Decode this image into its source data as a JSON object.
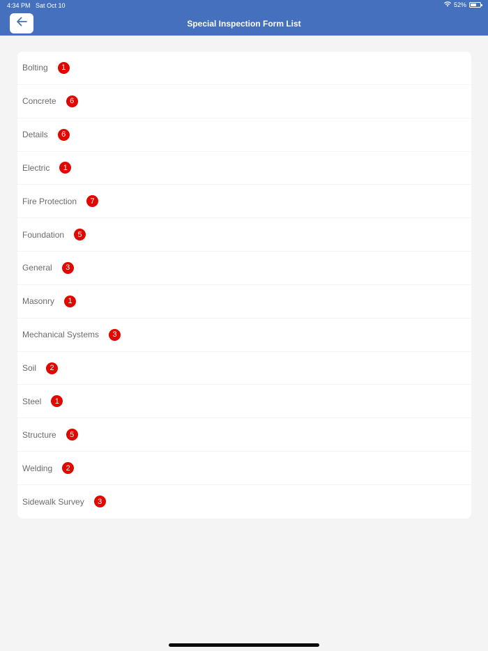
{
  "status_bar": {
    "time": "4:34 PM",
    "date": "Sat Oct 10",
    "battery": "52%"
  },
  "header": {
    "title": "Special Inspection Form List",
    "back_icon": "arrow-left-icon"
  },
  "colors": {
    "header_bg": "#4470bd",
    "badge_bg": "#e10600",
    "page_bg": "#f4f4f5"
  },
  "categories": [
    {
      "label": "Bolting",
      "count": "1"
    },
    {
      "label": "Concrete",
      "count": "6"
    },
    {
      "label": "Details",
      "count": "6"
    },
    {
      "label": "Electric",
      "count": "1"
    },
    {
      "label": "Fire Protection",
      "count": "7"
    },
    {
      "label": "Foundation",
      "count": "5"
    },
    {
      "label": "General",
      "count": "3"
    },
    {
      "label": "Masonry",
      "count": "1"
    },
    {
      "label": "Mechanical Systems",
      "count": "3"
    },
    {
      "label": "Soil",
      "count": "2"
    },
    {
      "label": "Steel",
      "count": "1"
    },
    {
      "label": "Structure",
      "count": "5"
    },
    {
      "label": "Welding",
      "count": "2"
    },
    {
      "label": "Sidewalk Survey",
      "count": "3"
    }
  ]
}
